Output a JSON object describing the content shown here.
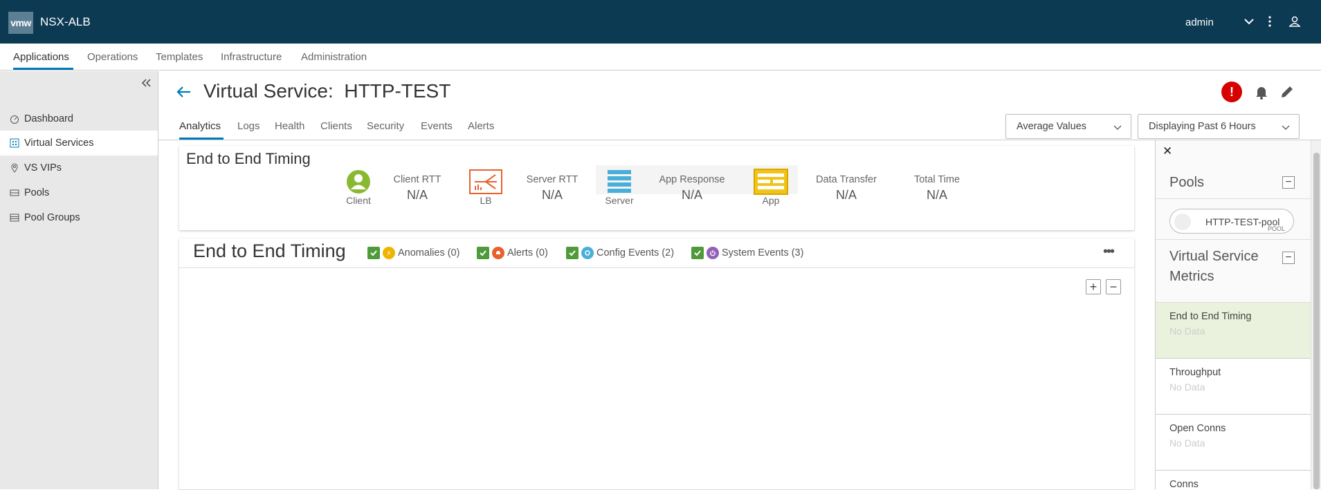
{
  "header": {
    "logo": "vmw",
    "app_name": "NSX-ALB",
    "user": "admin"
  },
  "topnav": [
    "Applications",
    "Operations",
    "Templates",
    "Infrastructure",
    "Administration"
  ],
  "sidebar": {
    "items": [
      "Dashboard",
      "Virtual Services",
      "VS VIPs",
      "Pools",
      "Pool Groups"
    ]
  },
  "page": {
    "title": "Virtual Service:  HTTP-TEST",
    "alert_symbol": "!"
  },
  "subtabs": [
    "Analytics",
    "Logs",
    "Health",
    "Clients",
    "Security",
    "Events",
    "Alerts"
  ],
  "selects": {
    "values": "Average Values",
    "period": "Displaying Past 6 Hours"
  },
  "e2e_card": {
    "title": "End to End Timing",
    "nodes": {
      "client": "Client",
      "lb": "LB",
      "server": "Server",
      "app": "App"
    },
    "metrics": [
      {
        "label": "Client RTT",
        "value": "N/A"
      },
      {
        "label": "Server RTT",
        "value": "N/A"
      },
      {
        "label": "App Response",
        "value": "N/A"
      },
      {
        "label": "Data Transfer",
        "value": "N/A"
      },
      {
        "label": "Total Time",
        "value": "N/A"
      }
    ]
  },
  "chart_card": {
    "title": "End to End Timing",
    "filters": [
      "Anomalies (0)",
      "Alerts (0)",
      "Config Events (2)",
      "System Events (3)"
    ],
    "more": "•••",
    "zoom_in": "+",
    "zoom_out": "−"
  },
  "right_panel": {
    "close": "✕",
    "pools_title": "Pools",
    "pool_name": "HTTP-TEST-pool",
    "pool_tag": "POOL",
    "vs_metrics_title_1": "Virtual Service",
    "vs_metrics_title_2": "Metrics",
    "collapse_symbol": "−",
    "metrics": [
      {
        "title": "End to End Timing",
        "sub": "No Data"
      },
      {
        "title": "Throughput",
        "sub": "No Data"
      },
      {
        "title": "Open Conns",
        "sub": "No Data"
      },
      {
        "title": "Conns",
        "sub": ""
      }
    ]
  },
  "colors": {
    "header_bg": "#0c3a53",
    "accent": "#0079b8",
    "alert_red": "#d60000",
    "check_green": "#4f9a39",
    "lb_orange": "#e8612c",
    "server_blue": "#49afd9",
    "app_yellow": "#f0c419",
    "client_green": "#8ab931"
  }
}
